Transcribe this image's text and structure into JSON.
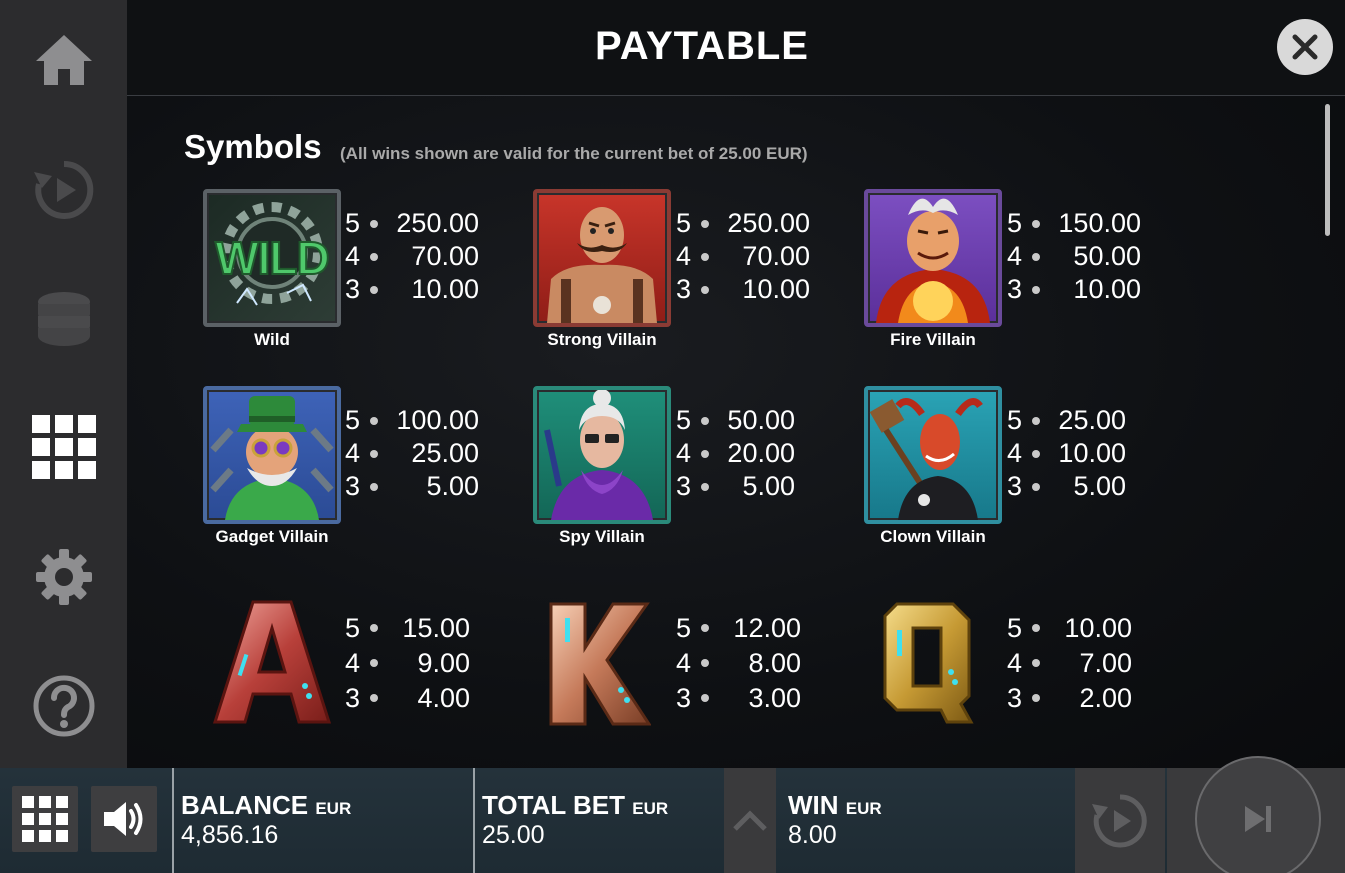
{
  "header": {
    "title": "PAYTABLE"
  },
  "section": {
    "title": "Symbols",
    "note": "(All wins shown are valid for the current bet of 25.00 EUR)"
  },
  "symbols": [
    {
      "name": "Wild",
      "pays": [
        {
          "count": "5",
          "value": "250.00"
        },
        {
          "count": "4",
          "value": "70.00"
        },
        {
          "count": "3",
          "value": "10.00"
        }
      ],
      "icon": "wild-gear-icon",
      "label_text": "WILD"
    },
    {
      "name": "Strong Villain",
      "pays": [
        {
          "count": "5",
          "value": "250.00"
        },
        {
          "count": "4",
          "value": "70.00"
        },
        {
          "count": "3",
          "value": "10.00"
        }
      ],
      "icon": "strong-villain-icon"
    },
    {
      "name": "Fire Villain",
      "pays": [
        {
          "count": "5",
          "value": "150.00"
        },
        {
          "count": "4",
          "value": "50.00"
        },
        {
          "count": "3",
          "value": "10.00"
        }
      ],
      "icon": "fire-villain-icon"
    },
    {
      "name": "Gadget Villain",
      "pays": [
        {
          "count": "5",
          "value": "100.00"
        },
        {
          "count": "4",
          "value": "25.00"
        },
        {
          "count": "3",
          "value": "5.00"
        }
      ],
      "icon": "gadget-villain-icon"
    },
    {
      "name": "Spy Villain",
      "pays": [
        {
          "count": "5",
          "value": "50.00"
        },
        {
          "count": "4",
          "value": "20.00"
        },
        {
          "count": "3",
          "value": "5.00"
        }
      ],
      "icon": "spy-villain-icon"
    },
    {
      "name": "Clown Villain",
      "pays": [
        {
          "count": "5",
          "value": "25.00"
        },
        {
          "count": "4",
          "value": "10.00"
        },
        {
          "count": "3",
          "value": "5.00"
        }
      ],
      "icon": "clown-villain-icon"
    },
    {
      "name": "A",
      "pays": [
        {
          "count": "5",
          "value": "15.00"
        },
        {
          "count": "4",
          "value": "9.00"
        },
        {
          "count": "3",
          "value": "4.00"
        }
      ],
      "icon": "letter-a-icon"
    },
    {
      "name": "K",
      "pays": [
        {
          "count": "5",
          "value": "12.00"
        },
        {
          "count": "4",
          "value": "8.00"
        },
        {
          "count": "3",
          "value": "3.00"
        }
      ],
      "icon": "letter-k-icon"
    },
    {
      "name": "Q",
      "pays": [
        {
          "count": "5",
          "value": "10.00"
        },
        {
          "count": "4",
          "value": "7.00"
        },
        {
          "count": "3",
          "value": "2.00"
        }
      ],
      "icon": "letter-q-icon"
    }
  ],
  "sidebar": {
    "items": [
      {
        "icon": "home-icon"
      },
      {
        "icon": "replay-icon"
      },
      {
        "icon": "coins-stack-icon"
      },
      {
        "icon": "paytable-grid-icon"
      },
      {
        "icon": "gear-icon"
      },
      {
        "icon": "help-icon"
      }
    ]
  },
  "bottom_bar": {
    "balance": {
      "label": "BALANCE",
      "currency": "EUR",
      "value": "4,856.16"
    },
    "total_bet": {
      "label": "TOTAL BET",
      "currency": "EUR",
      "value": "25.00"
    },
    "win": {
      "label": "WIN",
      "currency": "EUR",
      "value": "8.00"
    }
  },
  "colors": {
    "sidebar_bg": "#2c2c2e",
    "panel_bg": "#0e1013",
    "note_text": "#a9a9a9",
    "bottom_bg": "#24323b"
  }
}
